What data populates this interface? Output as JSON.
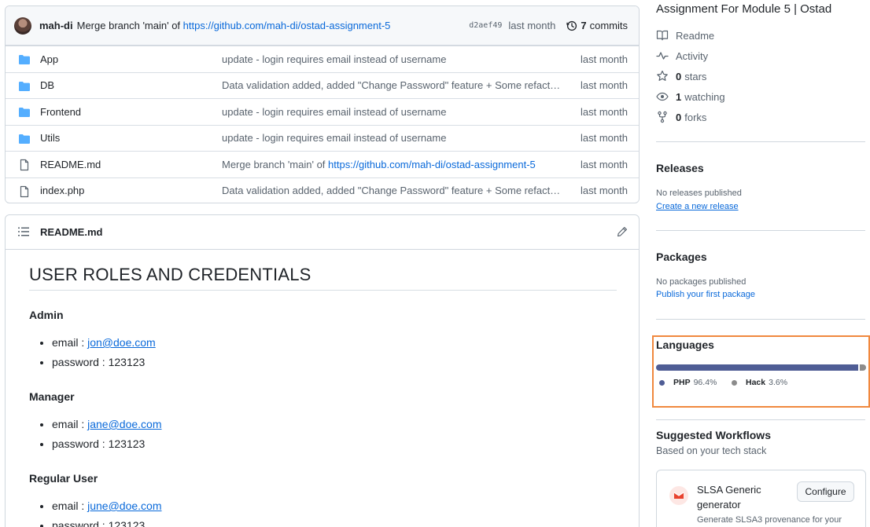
{
  "commit": {
    "author": "mah-di",
    "message_prefix": "Merge branch 'main' of ",
    "message_link": "https://github.com/mah-di/ostad-assignment-5",
    "sha": "d2aef49",
    "date": "last month",
    "commits_count": "7",
    "commits_label": "commits"
  },
  "files": [
    {
      "name": "App",
      "type": "folder",
      "message": "update - login requires email instead of username",
      "date": "last month"
    },
    {
      "name": "DB",
      "type": "folder",
      "message": "Data validation added, added \"Change Password\" feature + Some refact…",
      "date": "last month"
    },
    {
      "name": "Frontend",
      "type": "folder",
      "message": "update - login requires email instead of username",
      "date": "last month"
    },
    {
      "name": "Utils",
      "type": "folder",
      "message": "update - login requires email instead of username",
      "date": "last month"
    },
    {
      "name": "README.md",
      "type": "file",
      "message_prefix": "Merge branch 'main' of ",
      "message_link": "https://github.com/mah-di/ostad-assignment-5",
      "date": "last month"
    },
    {
      "name": "index.php",
      "type": "file",
      "message": "Data validation added, added \"Change Password\" feature + Some refact…",
      "date": "last month"
    }
  ],
  "readme": {
    "title": "README.md",
    "heading": "USER ROLES AND CREDENTIALS",
    "roles": [
      {
        "name": "Admin",
        "email_label": "email : ",
        "email": "jon@doe.com",
        "password_label": "password : ",
        "password": "123123"
      },
      {
        "name": "Manager",
        "email_label": "email : ",
        "email": "jane@doe.com",
        "password_label": "password : ",
        "password": "123123"
      },
      {
        "name": "Regular User",
        "email_label": "email : ",
        "email": "june@doe.com",
        "password_label": "password : ",
        "password": "123123"
      }
    ]
  },
  "sidebar": {
    "about": "Assignment For Module 5 | Ostad",
    "readme": "Readme",
    "activity": "Activity",
    "stars_count": "0",
    "stars_label": "stars",
    "watching_count": "1",
    "watching_label": "watching",
    "forks_count": "0",
    "forks_label": "forks",
    "releases_heading": "Releases",
    "releases_text": "No releases published",
    "releases_link": "Create a new release",
    "packages_heading": "Packages",
    "packages_text": "No packages published",
    "packages_link": "Publish your first package",
    "languages_heading": "Languages",
    "languages": [
      {
        "name": "PHP",
        "percent": "96.4%",
        "value": 96.4,
        "color": "#4F5D95"
      },
      {
        "name": "Hack",
        "percent": "3.6%",
        "value": 3.6,
        "color": "#8c8c8c"
      }
    ],
    "workflows_heading": "Suggested Workflows",
    "workflows_sub": "Based on your tech stack",
    "workflow": {
      "title": "SLSA Generic generator",
      "button": "Configure",
      "description": "Generate SLSA3 provenance for your"
    }
  }
}
